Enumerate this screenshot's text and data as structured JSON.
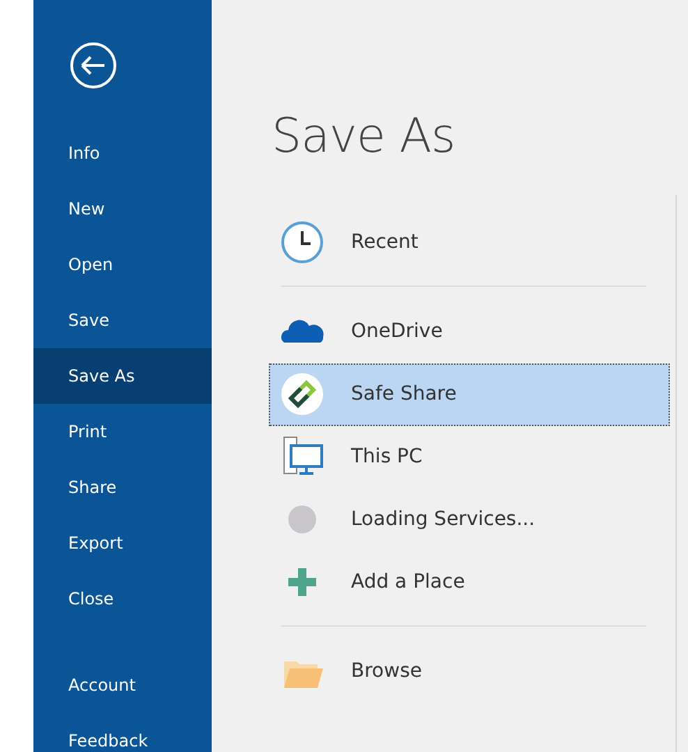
{
  "sidebar": {
    "menu": [
      {
        "label": "Info",
        "selected": false
      },
      {
        "label": "New",
        "selected": false
      },
      {
        "label": "Open",
        "selected": false
      },
      {
        "label": "Save",
        "selected": false
      },
      {
        "label": "Save As",
        "selected": true
      },
      {
        "label": "Print",
        "selected": false
      },
      {
        "label": "Share",
        "selected": false
      },
      {
        "label": "Export",
        "selected": false
      },
      {
        "label": "Close",
        "selected": false
      }
    ],
    "footer_menu": [
      {
        "label": "Account",
        "selected": false
      },
      {
        "label": "Feedback",
        "selected": false
      }
    ]
  },
  "page_title": "Save As",
  "place_groups": [
    [
      {
        "label": "Recent",
        "kind": "clock",
        "selected": false
      }
    ],
    [
      {
        "label": "OneDrive",
        "kind": "cloud",
        "selected": false
      },
      {
        "label": "Safe Share",
        "kind": "link",
        "selected": true
      },
      {
        "label": "This PC",
        "kind": "pc",
        "selected": false
      },
      {
        "label": "Loading Services...",
        "kind": "loading",
        "selected": false
      },
      {
        "label": "Add a Place",
        "kind": "plus",
        "selected": false
      }
    ],
    [
      {
        "label": "Browse",
        "kind": "folder",
        "selected": false
      }
    ]
  ]
}
